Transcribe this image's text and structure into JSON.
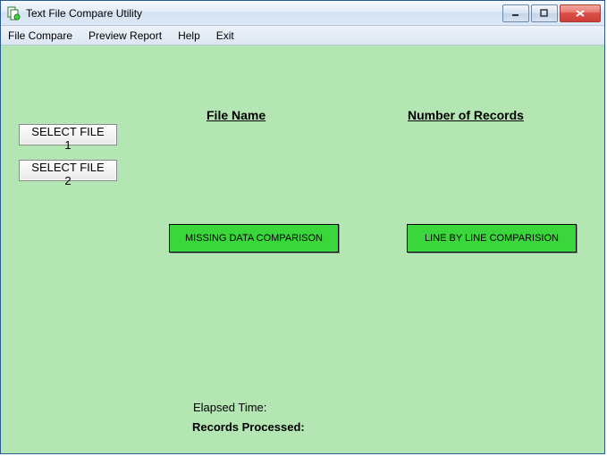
{
  "window": {
    "title": "Text File Compare Utility"
  },
  "menu": {
    "file_compare": "File Compare",
    "preview_report": "Preview Report",
    "help": "Help",
    "exit": "Exit"
  },
  "headers": {
    "file_name": "File Name",
    "number_of_records": "Number of Records"
  },
  "buttons": {
    "select_file_1": "SELECT FILE 1",
    "select_file_2": "SELECT FILE 2",
    "missing_data": "MISSING DATA COMPARISON",
    "line_by_line": "LINE BY LINE COMPARISION"
  },
  "labels": {
    "elapsed_time": "Elapsed Time:",
    "records_processed": "Records Processed:"
  }
}
